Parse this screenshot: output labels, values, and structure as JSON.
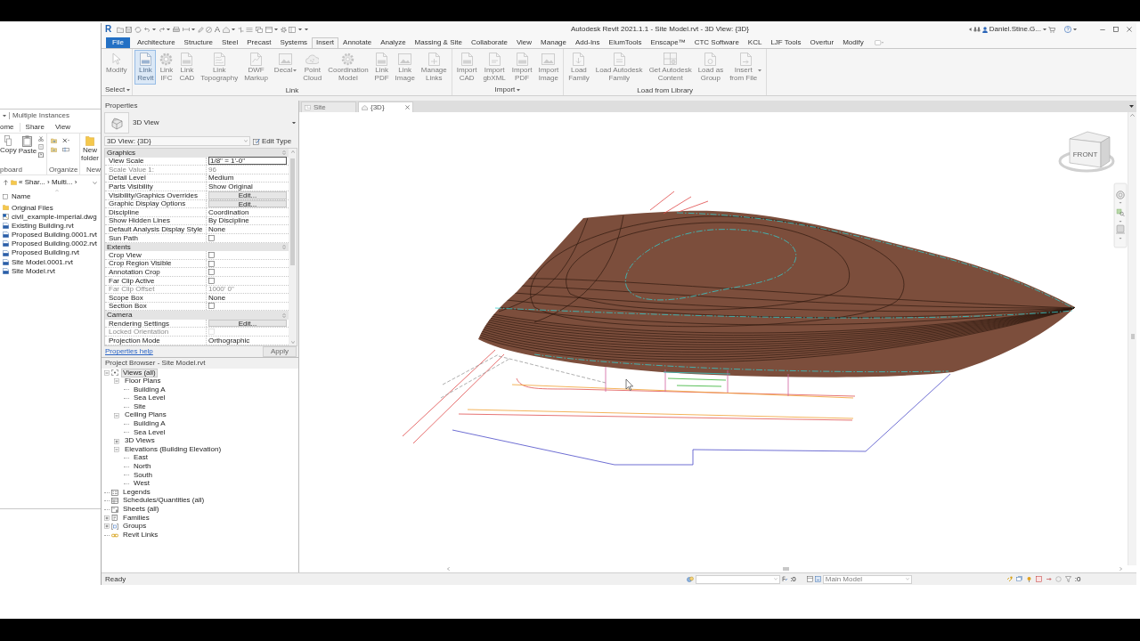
{
  "title_bar": {
    "logo": "R",
    "text_tool": "A",
    "title": "Autodesk Revit 2021.1.1 - Site Model.rvt - 3D View: {3D}",
    "user": "Daniel.Stine.G..."
  },
  "ribbon": {
    "tabs": [
      {
        "label": "File",
        "kind": "application",
        "selected": false
      },
      {
        "label": "Architecture",
        "kind": "tab",
        "selected": false
      },
      {
        "label": "Structure",
        "kind": "tab",
        "selected": false
      },
      {
        "label": "Steel",
        "kind": "tab",
        "selected": false
      },
      {
        "label": "Precast",
        "kind": "tab",
        "selected": false
      },
      {
        "label": "Systems",
        "kind": "tab",
        "selected": false
      },
      {
        "label": "Insert",
        "kind": "tab",
        "selected": true
      },
      {
        "label": "Annotate",
        "kind": "tab",
        "selected": false
      },
      {
        "label": "Analyze",
        "kind": "tab",
        "selected": false
      },
      {
        "label": "Massing & Site",
        "kind": "tab",
        "selected": false
      },
      {
        "label": "Collaborate",
        "kind": "tab",
        "selected": false
      },
      {
        "label": "View",
        "kind": "tab",
        "selected": false
      },
      {
        "label": "Manage",
        "kind": "tab",
        "selected": false
      },
      {
        "label": "Add-Ins",
        "kind": "tab",
        "selected": false
      },
      {
        "label": "ElumTools",
        "kind": "tab",
        "selected": false
      },
      {
        "label": "Enscape™",
        "kind": "tab",
        "selected": false
      },
      {
        "label": "CTC Software",
        "kind": "tab",
        "selected": false
      },
      {
        "label": "KCL",
        "kind": "tab",
        "selected": false
      },
      {
        "label": "LJF Tools",
        "kind": "tab",
        "selected": false
      },
      {
        "label": "Overtur",
        "kind": "tab",
        "selected": false
      },
      {
        "label": "Modify",
        "kind": "tab",
        "selected": false
      }
    ],
    "panels": [
      {
        "title": "Select",
        "dropdown": true,
        "buttons": [
          {
            "label": "Modify",
            "highlighted": false,
            "dropdown": false
          }
        ]
      },
      {
        "title": "Link",
        "dropdown": false,
        "buttons": [
          {
            "label": "Link\nRevit",
            "highlighted": true,
            "dropdown": false
          },
          {
            "label": "Link\nIFC",
            "highlighted": false,
            "dropdown": false
          },
          {
            "label": "Link\nCAD",
            "highlighted": false,
            "dropdown": false
          },
          {
            "label": "Link\nTopography",
            "highlighted": false,
            "dropdown": false
          },
          {
            "label": "DWF\nMarkup",
            "highlighted": false,
            "dropdown": false
          },
          {
            "label": "Decal",
            "highlighted": false,
            "dropdown": true
          },
          {
            "label": "Point\nCloud",
            "highlighted": false,
            "dropdown": false
          },
          {
            "label": "Coordination\nModel",
            "highlighted": false,
            "dropdown": false
          },
          {
            "label": "Link\nPDF",
            "highlighted": false,
            "dropdown": false
          },
          {
            "label": "Link\nImage",
            "highlighted": false,
            "dropdown": false
          },
          {
            "label": "Manage\nLinks",
            "highlighted": false,
            "dropdown": false
          }
        ]
      },
      {
        "title": "Import",
        "dropdown": true,
        "buttons": [
          {
            "label": "Import\nCAD",
            "highlighted": false,
            "dropdown": false
          },
          {
            "label": "Import\ngbXML",
            "highlighted": false,
            "dropdown": false
          },
          {
            "label": "Import\nPDF",
            "highlighted": false,
            "dropdown": false
          },
          {
            "label": "Import\nImage",
            "highlighted": false,
            "dropdown": false
          }
        ]
      },
      {
        "title": "Load from Library",
        "dropdown": false,
        "buttons": [
          {
            "label": "Load\nFamily",
            "highlighted": false,
            "dropdown": false
          },
          {
            "label": "Load Autodesk\nFamily",
            "highlighted": false,
            "dropdown": false
          },
          {
            "label": "Get Autodesk\nContent",
            "highlighted": false,
            "dropdown": false
          },
          {
            "label": "Load as\nGroup",
            "highlighted": false,
            "dropdown": false
          },
          {
            "label": "Insert\nfrom File",
            "highlighted": false,
            "dropdown": true
          }
        ]
      }
    ]
  },
  "explorer": {
    "title": "Multiple Instances",
    "tabs": [
      {
        "label": "ome",
        "selected": true
      },
      {
        "label": "Share",
        "selected": false
      },
      {
        "label": "View",
        "selected": false
      }
    ],
    "groups": [
      {
        "title": "pboard",
        "buttons": [
          "Copy",
          "Paste"
        ]
      },
      {
        "title": "Organize"
      },
      {
        "title": "New",
        "buttons": [
          "New\nfolder"
        ]
      }
    ],
    "address": "« Shar... › Multi... ›",
    "select_all_checked": false,
    "column": "Name",
    "files": [
      {
        "name": "Original Files",
        "kind": "folder"
      },
      {
        "name": "civil_example-imperial.dwg",
        "kind": "dwg"
      },
      {
        "name": "Existing Building.rvt",
        "kind": "rvt"
      },
      {
        "name": "Proposed Building.0001.rvt",
        "kind": "rvt"
      },
      {
        "name": "Proposed Building.0002.rvt",
        "kind": "rvt"
      },
      {
        "name": "Proposed Building.rvt",
        "kind": "rvt"
      },
      {
        "name": "Site Model.0001.rvt",
        "kind": "rvt"
      },
      {
        "name": "Site Model.rvt",
        "kind": "rvt"
      }
    ]
  },
  "properties": {
    "title": "Properties",
    "type_name": "3D View",
    "instance": "3D View: {3D}",
    "edit_type": "Edit Type",
    "groups": [
      {
        "name": "Graphics",
        "rows": [
          {
            "label": "View Scale",
            "kind": "input",
            "value": "1/8\" = 1'-0\"",
            "disabled": false
          },
          {
            "label": "Scale Value 1:",
            "kind": "text",
            "value": "96",
            "disabled": true
          },
          {
            "label": "Detail Level",
            "kind": "text",
            "value": "Medium",
            "disabled": false
          },
          {
            "label": "Parts Visibility",
            "kind": "text",
            "value": "Show Original",
            "disabled": false
          },
          {
            "label": "Visibility/Graphics Overrides",
            "kind": "button",
            "value": "Edit...",
            "disabled": false
          },
          {
            "label": "Graphic Display Options",
            "kind": "button",
            "value": "Edit...",
            "disabled": false
          },
          {
            "label": "Discipline",
            "kind": "text",
            "value": "Coordination",
            "disabled": false
          },
          {
            "label": "Show Hidden Lines",
            "kind": "text",
            "value": "By Discipline",
            "disabled": false
          },
          {
            "label": "Default Analysis Display Style",
            "kind": "text",
            "value": "None",
            "disabled": false
          },
          {
            "label": "Sun Path",
            "kind": "checkbox",
            "checked": false,
            "disabled": false
          }
        ]
      },
      {
        "name": "Extents",
        "rows": [
          {
            "label": "Crop View",
            "kind": "checkbox",
            "checked": false,
            "disabled": false
          },
          {
            "label": "Crop Region Visible",
            "kind": "checkbox",
            "checked": false,
            "disabled": false
          },
          {
            "label": "Annotation Crop",
            "kind": "checkbox",
            "checked": false,
            "disabled": false
          },
          {
            "label": "Far Clip Active",
            "kind": "checkbox",
            "checked": false,
            "disabled": false
          },
          {
            "label": "Far Clip Offset",
            "kind": "text",
            "value": "1000' 0\"",
            "disabled": true
          },
          {
            "label": "Scope Box",
            "kind": "text",
            "value": "None",
            "disabled": false
          },
          {
            "label": "Section Box",
            "kind": "checkbox",
            "checked": false,
            "disabled": false
          }
        ]
      },
      {
        "name": "Camera",
        "rows": [
          {
            "label": "Rendering Settings",
            "kind": "button",
            "value": "Edit...",
            "disabled": false
          },
          {
            "label": "Locked Orientation",
            "kind": "checkbox",
            "checked": false,
            "disabled": true
          },
          {
            "label": "Projection Mode",
            "kind": "text",
            "value": "Orthographic",
            "disabled": false
          }
        ]
      }
    ],
    "help": "Properties help",
    "apply": "Apply",
    "apply_disabled": true
  },
  "project_browser": {
    "title": "Project Browser - Site Model.rvt",
    "tree": [
      {
        "label": "Views (all)",
        "kind": "views",
        "expanded": true,
        "selected": true,
        "children": [
          {
            "label": "Floor Plans",
            "expanded": true,
            "selected": false,
            "children": [
              {
                "label": "Building A",
                "selected": false
              },
              {
                "label": "Sea Level",
                "selected": false
              },
              {
                "label": "Site",
                "selected": false
              }
            ]
          },
          {
            "label": "Ceiling Plans",
            "expanded": true,
            "selected": false,
            "children": [
              {
                "label": "Building A",
                "selected": false
              },
              {
                "label": "Sea Level",
                "selected": false
              }
            ]
          },
          {
            "label": "3D Views",
            "expanded": false,
            "selected": false
          },
          {
            "label": "Elevations (Building Elevation)",
            "expanded": true,
            "selected": false,
            "children": [
              {
                "label": "East",
                "selected": false
              },
              {
                "label": "North",
                "selected": false
              },
              {
                "label": "South",
                "selected": false
              },
              {
                "label": "West",
                "selected": false
              }
            ]
          }
        ]
      },
      {
        "label": "Legends",
        "kind": "legends",
        "selected": false
      },
      {
        "label": "Schedules/Quantities (all)",
        "kind": "schedules",
        "selected": false
      },
      {
        "label": "Sheets (all)",
        "kind": "sheets",
        "selected": false
      },
      {
        "label": "Families",
        "kind": "families",
        "expanded": false,
        "selected": false
      },
      {
        "label": "Groups",
        "kind": "groups",
        "expanded": false,
        "selected": false
      },
      {
        "label": "Revit Links",
        "kind": "links",
        "selected": false
      }
    ]
  },
  "view": {
    "tabs": [
      {
        "label": "Site",
        "kind": "plan",
        "selected": false
      },
      {
        "label": "{3D}",
        "kind": "model",
        "selected": true
      }
    ],
    "viewcube_label": "FRONT"
  },
  "status_bar": {
    "message": "Ready",
    "count": ":0",
    "model": "Main Model",
    "filter_count": ":0"
  }
}
